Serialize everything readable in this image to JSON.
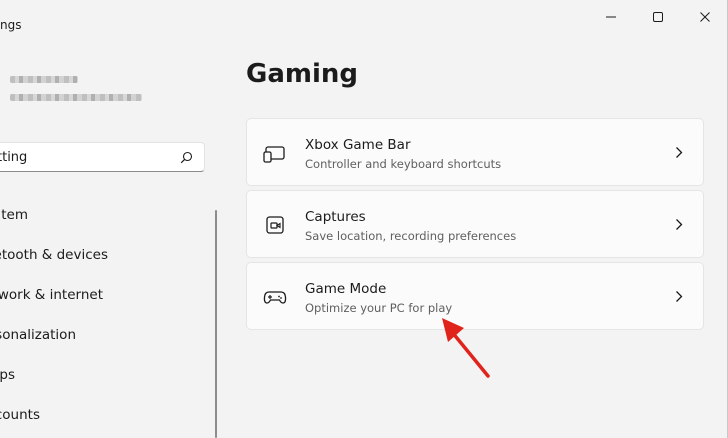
{
  "window": {
    "title_fragment": "ngs"
  },
  "sidebar": {
    "search": {
      "value": "etting"
    },
    "items": [
      {
        "label": "tem"
      },
      {
        "label": "etooth & devices"
      },
      {
        "label": "work & internet"
      },
      {
        "label": "sonalization"
      },
      {
        "label": "ps"
      },
      {
        "label": "counts"
      }
    ]
  },
  "main": {
    "title": "Gaming",
    "cards": [
      {
        "icon": "game-bar-icon",
        "title": "Xbox Game Bar",
        "subtitle": "Controller and keyboard shortcuts"
      },
      {
        "icon": "captures-icon",
        "title": "Captures",
        "subtitle": "Save location, recording preferences"
      },
      {
        "icon": "game-mode-icon",
        "title": "Game Mode",
        "subtitle": "Optimize your PC for play"
      }
    ]
  },
  "colors": {
    "background": "#f3f3f3",
    "card": "#fbfbfb",
    "annotation_arrow": "#e0241b"
  }
}
